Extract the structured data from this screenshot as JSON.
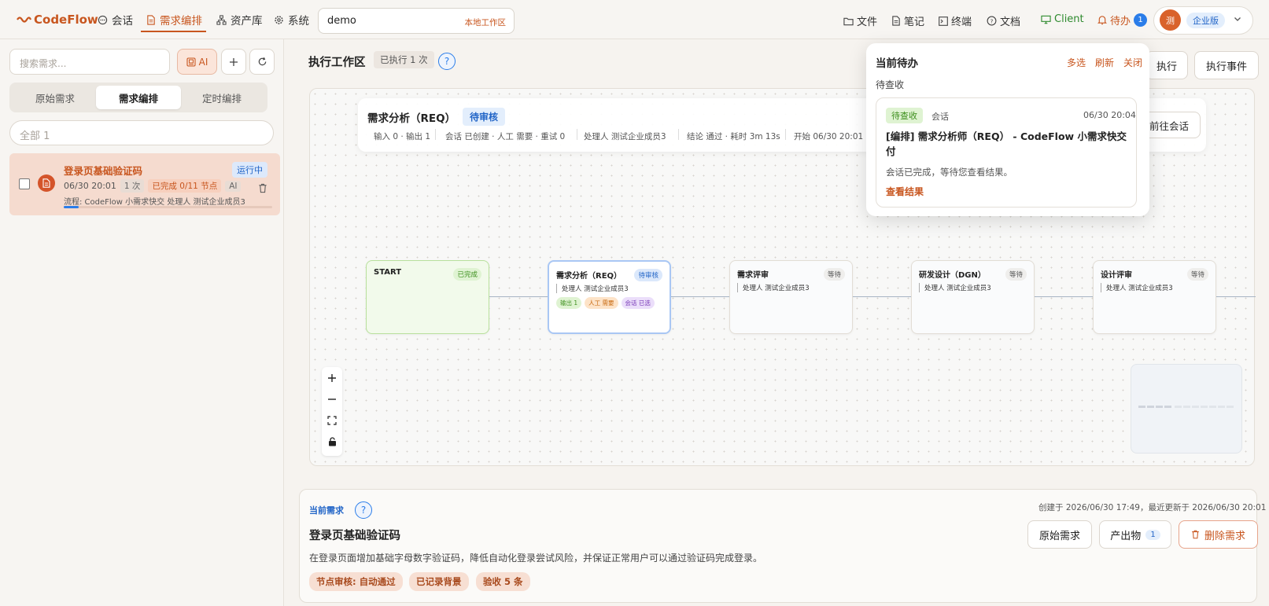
{
  "topbar": {
    "logo": "CodeFlow",
    "nav": [
      {
        "label": "会话",
        "icon": "chat-icon"
      },
      {
        "label": "需求编排",
        "icon": "doc-icon",
        "active": true
      },
      {
        "label": "资产库",
        "icon": "sitemap-icon"
      },
      {
        "label": "系统",
        "icon": "gear-icon"
      }
    ],
    "workspace": {
      "value": "demo",
      "tag": "本地工作区"
    },
    "tools": [
      {
        "label": "文件",
        "icon": "folder-icon"
      },
      {
        "label": "笔记",
        "icon": "note-icon"
      },
      {
        "label": "终端",
        "icon": "terminal-icon"
      },
      {
        "label": "文档",
        "icon": "help-icon"
      },
      {
        "label": "Client",
        "icon": "monitor-icon"
      },
      {
        "label": "待办",
        "icon": "bell-icon",
        "count": "1"
      }
    ],
    "user": {
      "avatar": "测",
      "edition": "企业版"
    }
  },
  "sidebar": {
    "search_placeholder": "搜索需求...",
    "ai_label": "AI",
    "tabs": [
      "原始需求",
      "需求编排",
      "定时编排"
    ],
    "active_tab": 1,
    "filter_placeholder": "全部 1",
    "items": [
      {
        "title": "登录页基础验证码",
        "status": "运行中",
        "time": "06/30 20:01",
        "runs": "1 次",
        "progress_text": "已完成 0/11 节点",
        "ai": "AI",
        "flow": "流程: CodeFlow 小需求快交",
        "owner": "处理人 测试企业成员3",
        "progress": 0.07
      }
    ]
  },
  "workspace": {
    "title": "执行工作区",
    "exec_count": "已执行 1 次",
    "help": "?",
    "buttons": {
      "execute": "执行",
      "events": "执行事件"
    }
  },
  "infobar": {
    "title": "需求分析（REQ）",
    "status": "待审核",
    "meta": [
      "输入 0 · 输出 1",
      "会话 已创建 · 人工 需要 · 重试 0",
      "处理人 测试企业成员3",
      "结论 通过 · 耗时 3m 13s",
      "开始 06/30 20:01"
    ],
    "goto": "前往会话"
  },
  "nodes": [
    {
      "title": "START",
      "badge": "已完成",
      "kind": "g"
    },
    {
      "title": "需求分析（REQ）",
      "badge": "待审核",
      "kind": "b",
      "owner": "处理人 测试企业成员3",
      "tags": [
        "输出 1",
        "人工 需要",
        "会话 已选"
      ]
    },
    {
      "title": "需求评审",
      "badge": "等待",
      "kind": "w",
      "owner": "处理人 测试企业成员3"
    },
    {
      "title": "研发设计（DGN）",
      "badge": "等待",
      "kind": "w",
      "owner": "处理人 测试企业成员3"
    },
    {
      "title": "设计评审",
      "badge": "等待",
      "kind": "w",
      "owner": "处理人 测试企业成员3"
    }
  ],
  "popover": {
    "title": "当前待办",
    "actions": [
      "多选",
      "刷新",
      "关闭"
    ],
    "section": "待查收",
    "card": {
      "tag": "待查收",
      "type": "会话",
      "time": "06/30 20:04",
      "title": "[编排] 需求分析师（REQ） - CodeFlow 小需求快交付",
      "desc": "会话已完成，等待您查看结果。",
      "link": "查看结果"
    }
  },
  "current": {
    "label": "当前需求",
    "created": "创建于 2026/06/30 17:49，最近更新于 2026/06/30 20:01",
    "title": "登录页基础验证码",
    "desc": "在登录页面增加基础字母数字验证码，降低自动化登录尝试风险，并保证正常用户可以通过验证码完成登录。",
    "chips": [
      "节点审核: 自动通过",
      "已记录背景",
      "验收 5 条"
    ],
    "buttons": {
      "raw": "原始需求",
      "artifacts": "产出物",
      "artifacts_count": "1",
      "delete": "删除需求"
    }
  }
}
